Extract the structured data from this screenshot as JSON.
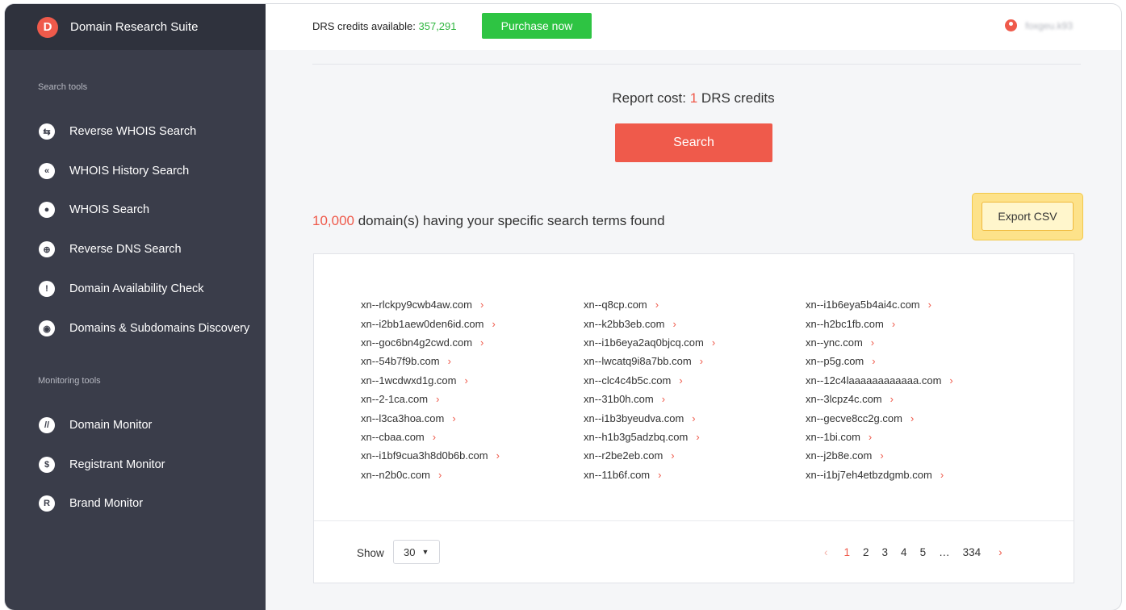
{
  "app": {
    "title": "Domain Research Suite",
    "logo_letter": "D"
  },
  "sidebar": {
    "search_section_label": "Search tools",
    "search_items": [
      {
        "label": "Reverse WHOIS Search",
        "icon": "reverse-whois-icon",
        "glyph": "⇆"
      },
      {
        "label": "WHOIS History Search",
        "icon": "history-icon",
        "glyph": "«"
      },
      {
        "label": "WHOIS Search",
        "icon": "user-circle-icon",
        "glyph": "●"
      },
      {
        "label": "Reverse DNS Search",
        "icon": "globe-icon",
        "glyph": "⊕"
      },
      {
        "label": "Domain Availability Check",
        "icon": "alert-icon",
        "glyph": "!"
      },
      {
        "label": "Domains & Subdomains Discovery",
        "icon": "target-icon",
        "glyph": "◉"
      }
    ],
    "monitoring_section_label": "Monitoring tools",
    "monitoring_items": [
      {
        "label": "Domain Monitor",
        "icon": "domain-monitor-icon",
        "glyph": "//"
      },
      {
        "label": "Registrant Monitor",
        "icon": "registrant-icon",
        "glyph": "$"
      },
      {
        "label": "Brand Monitor",
        "icon": "brand-icon",
        "glyph": "R"
      }
    ]
  },
  "topbar": {
    "credits_label": "DRS credits available: ",
    "credits_value": "357,291",
    "purchase_label": "Purchase now",
    "username": "foxgeu.k93"
  },
  "main": {
    "report_cost_prefix": "Report cost: ",
    "report_cost_value": "1",
    "report_cost_suffix": " DRS credits",
    "search_label": "Search",
    "found_count": "10,000",
    "found_text": " domain(s) having your specific search terms found",
    "export_label": "Export CSV"
  },
  "results": {
    "columns": [
      [
        "xn--rlckpy9cwb4aw.com",
        "xn--i2bb1aew0den6id.com",
        "xn--goc6bn4g2cwd.com",
        "xn--54b7f9b.com",
        "xn--1wcdwxd1g.com",
        "xn--2-1ca.com",
        "xn--l3ca3hoa.com",
        "xn--cbaa.com",
        "xn--i1bf9cua3h8d0b6b.com",
        "xn--n2b0c.com"
      ],
      [
        "xn--q8cp.com",
        "xn--k2bb3eb.com",
        "xn--i1b6eya2aq0bjcq.com",
        "xn--lwcatq9i8a7bb.com",
        "xn--clc4c4b5c.com",
        "xn--31b0h.com",
        "xn--i1b3byeudva.com",
        "xn--h1b3g5adzbq.com",
        "xn--r2be2eb.com",
        "xn--11b6f.com"
      ],
      [
        "xn--i1b6eya5b4ai4c.com",
        "xn--h2bc1fb.com",
        "xn--ync.com",
        "xn--p5g.com",
        "xn--12c4laaaaaaaaaaaa.com",
        "xn--3lcpz4c.com",
        "xn--gecve8cc2g.com",
        "xn--1bi.com",
        "xn--j2b8e.com",
        "xn--i1bj7eh4etbzdgmb.com"
      ]
    ]
  },
  "pagination": {
    "show_label": "Show",
    "page_size": "30",
    "prev": "‹",
    "pages": [
      "1",
      "2",
      "3",
      "4",
      "5"
    ],
    "ellipsis": "…",
    "last_page": "334",
    "next": "›",
    "current": "1"
  },
  "colors": {
    "accent": "#ef5a4b",
    "success": "#2ec443",
    "sidebar_bg": "#3a3d4a",
    "highlight": "#fde28a"
  }
}
